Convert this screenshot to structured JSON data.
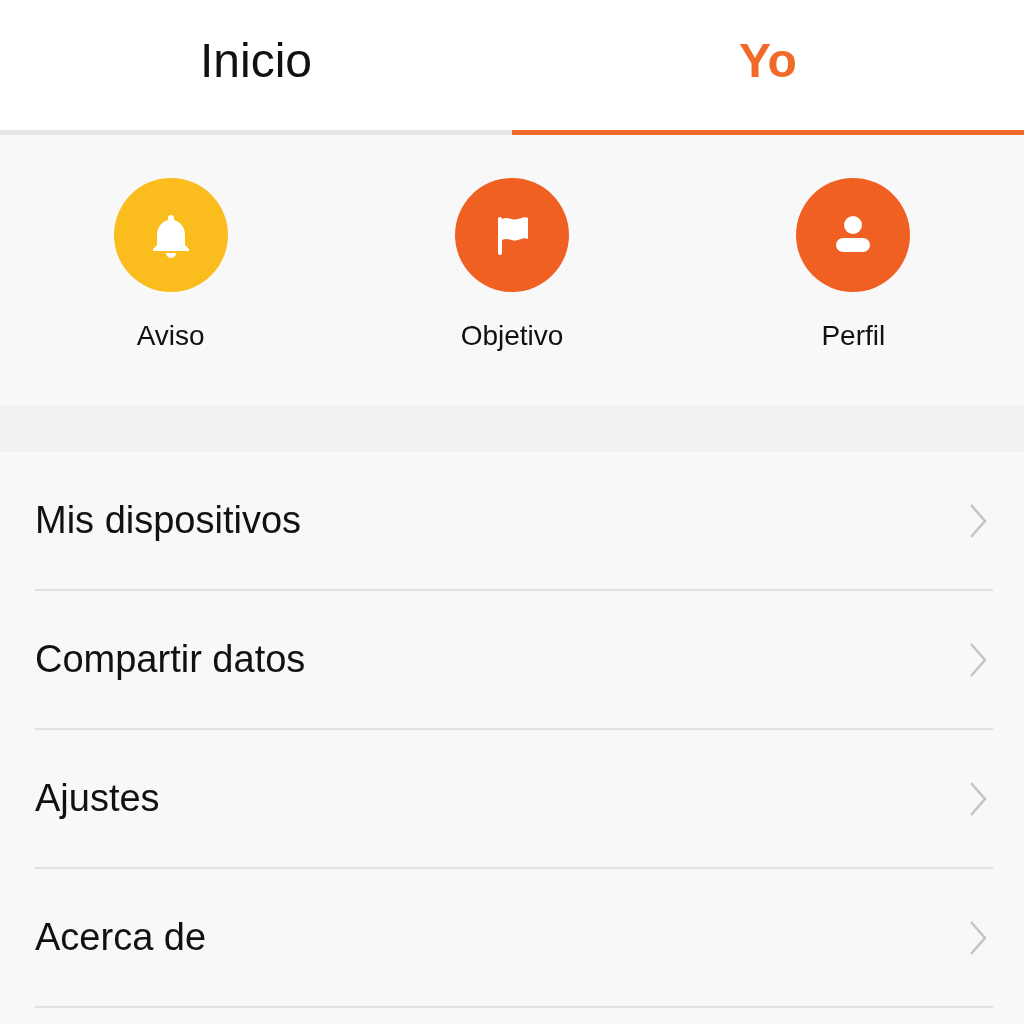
{
  "tabs": [
    {
      "label": "Inicio",
      "selected": false
    },
    {
      "label": "Yo",
      "selected": true
    }
  ],
  "shortcuts": [
    {
      "label": "Aviso",
      "kind": "bell",
      "color": "#fbbc1e"
    },
    {
      "label": "Objetivo",
      "kind": "flag",
      "color": "#f06022"
    },
    {
      "label": "Perfil",
      "kind": "person",
      "color": "#f06022"
    }
  ],
  "menu": [
    {
      "label": "Mis dispositivos"
    },
    {
      "label": "Compartir datos"
    },
    {
      "label": "Ajustes"
    },
    {
      "label": "Acerca de"
    }
  ]
}
